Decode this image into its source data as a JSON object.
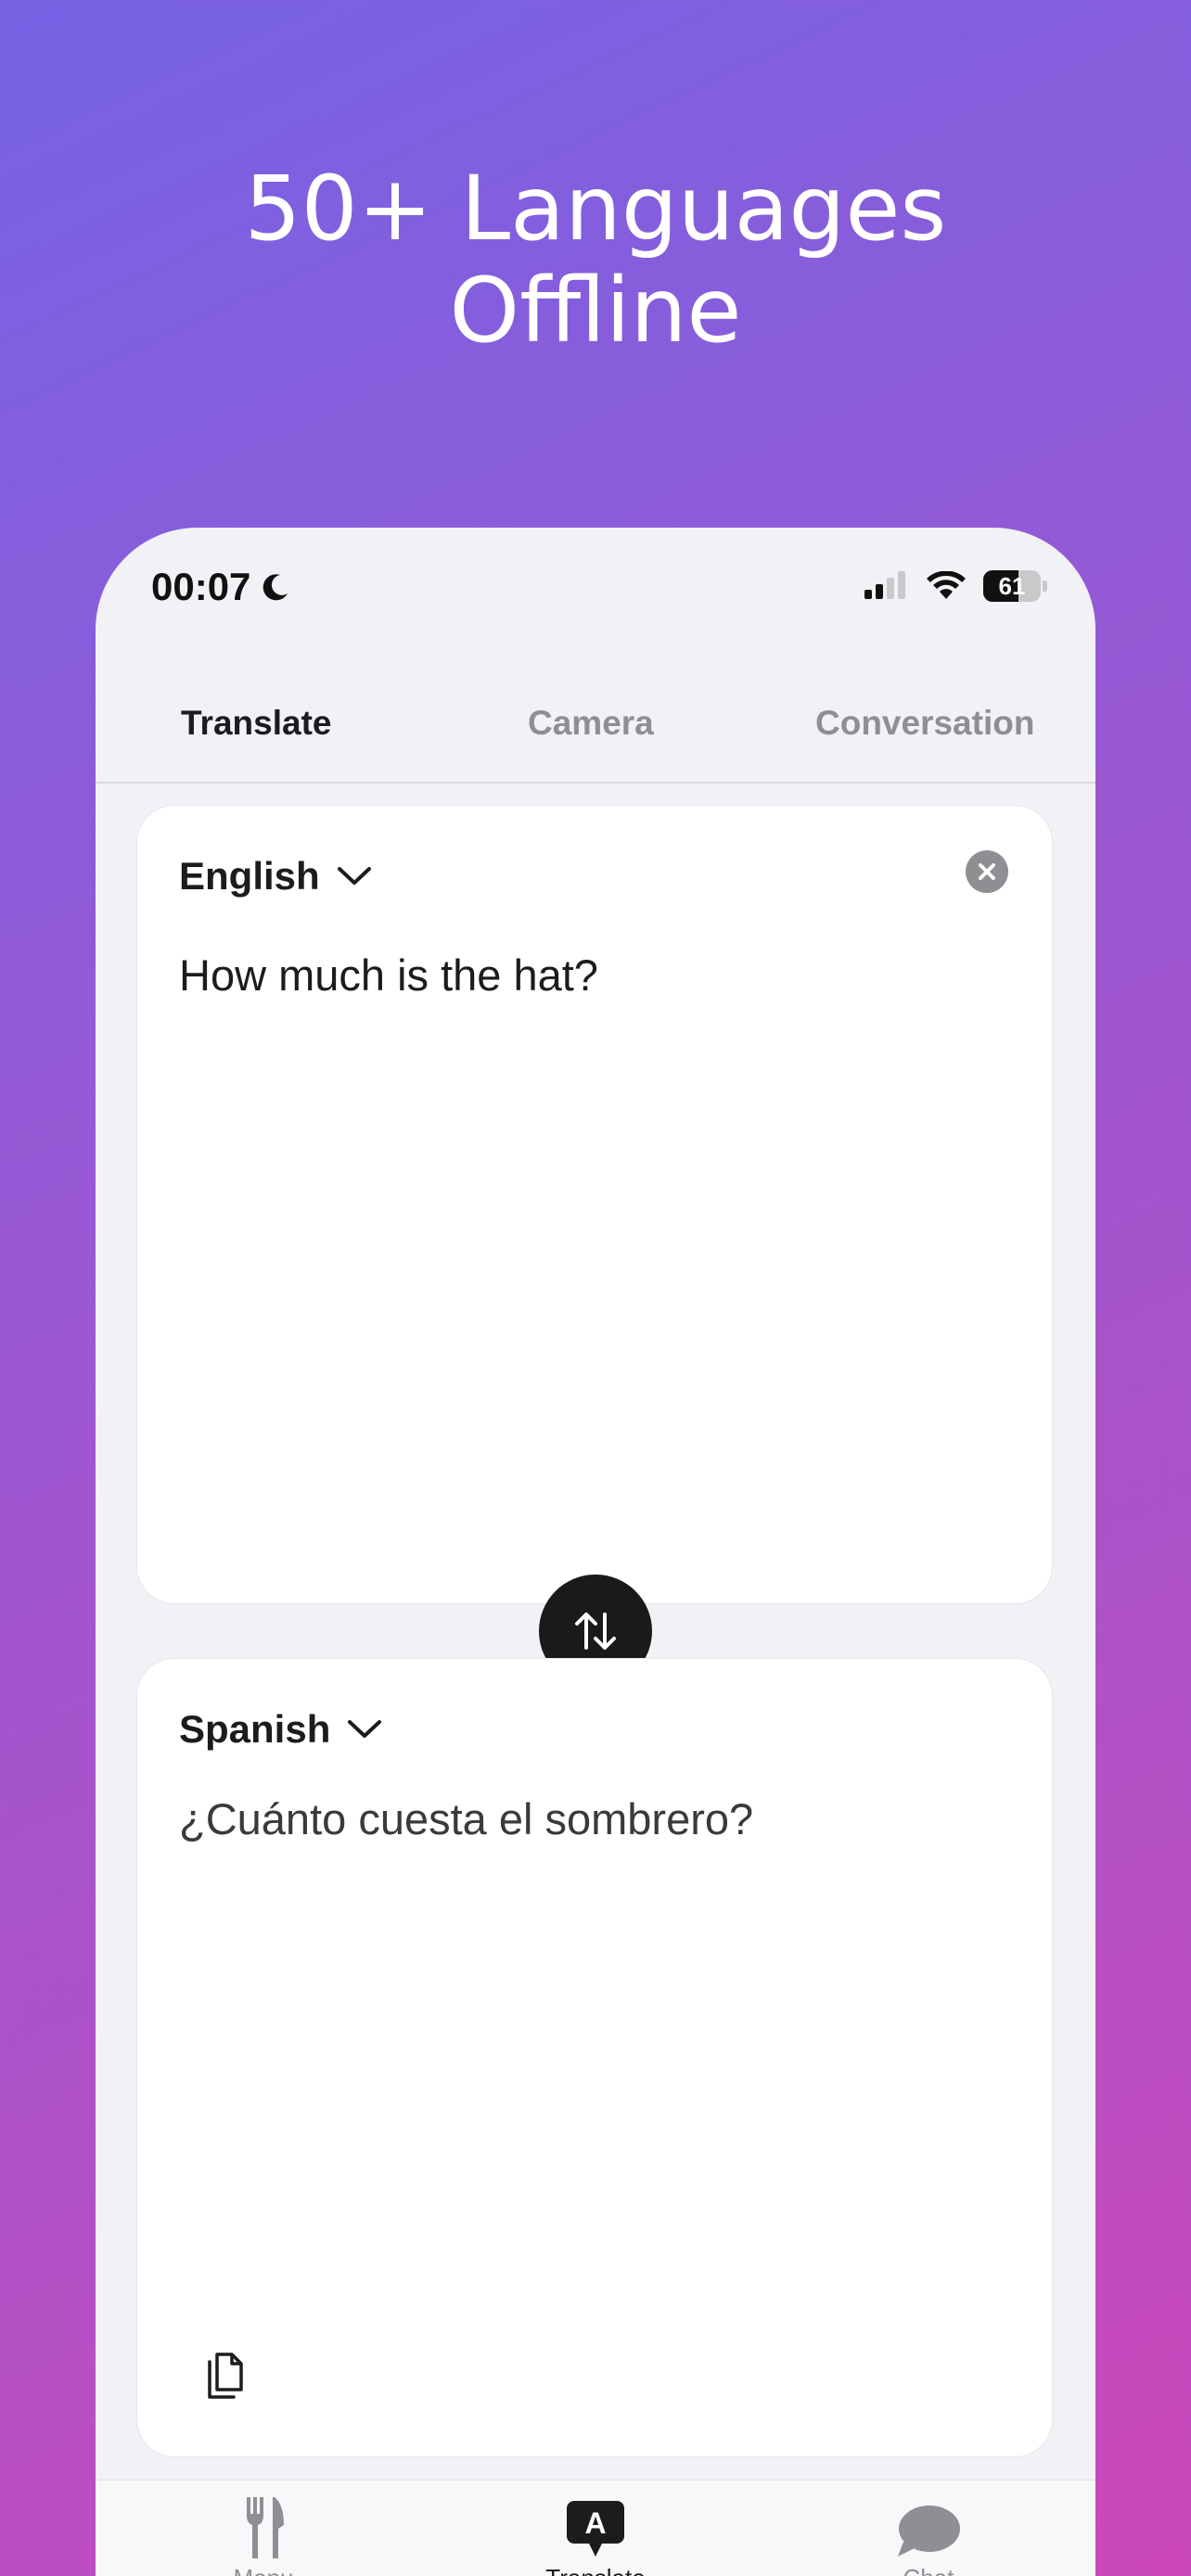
{
  "headline": {
    "line1": "50+ Languages",
    "line2": "Offline"
  },
  "status_bar": {
    "time": "00:07",
    "battery": "61",
    "battery_level": 0.61,
    "icons": [
      "moon-icon",
      "signal-icon",
      "wifi-icon",
      "battery-icon"
    ]
  },
  "tabs": [
    {
      "label": "Translate",
      "active": true
    },
    {
      "label": "Camera",
      "active": false
    },
    {
      "label": "Conversation",
      "active": false
    }
  ],
  "source": {
    "language": "English",
    "text": "How much is the hat?"
  },
  "target": {
    "language": "Spanish",
    "text": "¿Cuánto cuesta el sombrero?"
  },
  "bottom_nav": [
    {
      "label": "Menu",
      "icon": "fork-knife-icon",
      "active": false
    },
    {
      "label": "Translate",
      "icon": "translate-bubble-icon",
      "active": true
    },
    {
      "label": "Chat",
      "icon": "chat-bubble-icon",
      "active": false
    }
  ],
  "colors": {
    "gradient_start": "#7563e4",
    "gradient_end": "#cc47b9",
    "phone_bg": "#f2f1f6",
    "card_bg": "#ffffff",
    "swap_button": "#1a1a1a"
  }
}
